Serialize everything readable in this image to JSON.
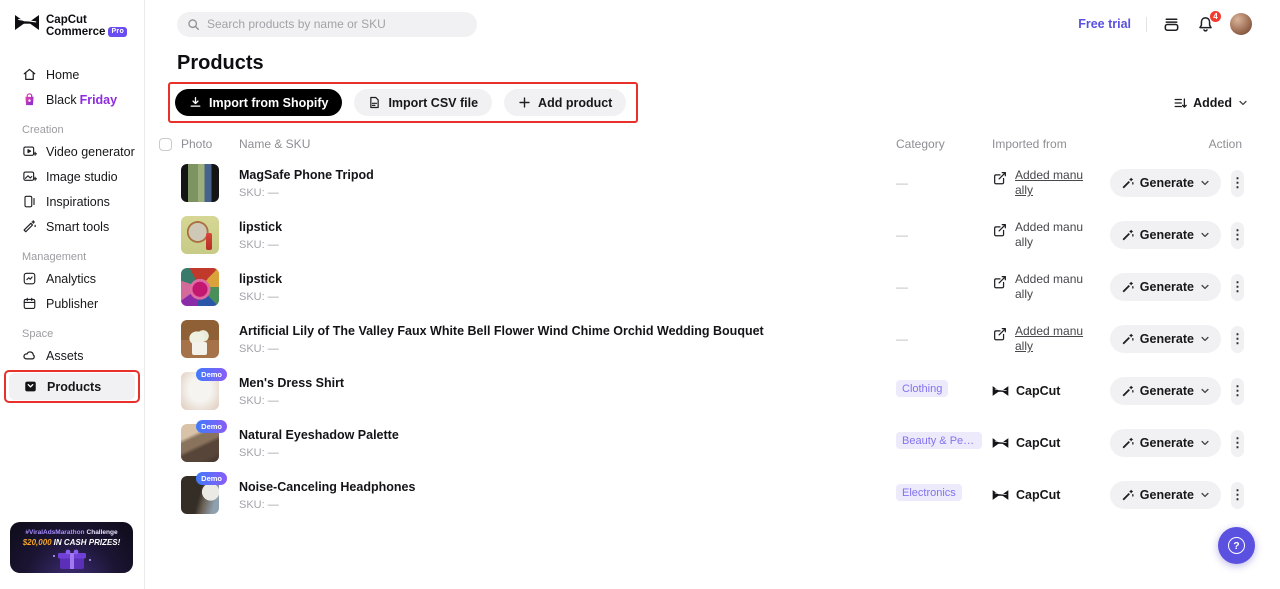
{
  "sidebar": {
    "logo": {
      "line1": "CapCut",
      "line2": "Commerce",
      "badge": "Pro"
    },
    "home": "Home",
    "black_friday": {
      "first": "Black",
      "second": "Friday"
    },
    "sections": [
      {
        "label": "Creation",
        "items": [
          "Video generator",
          "Image studio",
          "Inspirations",
          "Smart tools"
        ]
      },
      {
        "label": "Management",
        "items": [
          "Analytics",
          "Publisher"
        ]
      },
      {
        "label": "Space",
        "items": [
          "Assets",
          "Products"
        ]
      }
    ],
    "banner": {
      "line1_highlight": "#ViralAdsMarathon",
      "line1_rest": "Challenge",
      "line2_amount": "$20,000",
      "line2_rest": "IN CASH PRIZES!"
    }
  },
  "topbar": {
    "search_placeholder": "Search products by name or SKU",
    "free_trial": "Free trial",
    "notification_count": "4"
  },
  "page": {
    "title": "Products"
  },
  "toolbar": {
    "import_shopify": "Import from Shopify",
    "import_csv": "Import CSV file",
    "add_product": "Add product",
    "sort_label": "Added"
  },
  "table": {
    "headers": {
      "photo": "Photo",
      "name_sku": "Name & SKU",
      "category": "Category",
      "imported_from": "Imported from",
      "action": "Action"
    },
    "sku_prefix": "SKU:",
    "category_empty": "—",
    "demo_badge": "Demo",
    "generate_label": "Generate",
    "imported_manual_label": "Added manually",
    "imported_capcut_label": "CapCut",
    "rows": [
      {
        "name": "MagSafe Phone Tripod",
        "sku": "—",
        "category": null,
        "imported": "manual",
        "manual_underline": true,
        "demo": false,
        "photo": "tripod"
      },
      {
        "name": "lipstick",
        "sku": "—",
        "category": null,
        "imported": "manual",
        "manual_underline": false,
        "demo": false,
        "photo": "lipstick-mirror"
      },
      {
        "name": "lipstick",
        "sku": "—",
        "category": null,
        "imported": "manual",
        "manual_underline": false,
        "demo": false,
        "photo": "lipstick-ring"
      },
      {
        "name": "Artificial Lily of The Valley Faux White Bell Flower Wind Chime Orchid Wedding Bouquet",
        "sku": "—",
        "category": null,
        "imported": "manual",
        "manual_underline": true,
        "demo": false,
        "photo": "lily"
      },
      {
        "name": "Men's Dress Shirt",
        "sku": "—",
        "category": "Clothing",
        "imported": "capcut",
        "manual_underline": false,
        "demo": true,
        "photo": "shirt"
      },
      {
        "name": "Natural Eyeshadow Palette",
        "sku": "—",
        "category": "Beauty & Pers...",
        "imported": "capcut",
        "manual_underline": false,
        "demo": true,
        "photo": "palette"
      },
      {
        "name": "Noise-Canceling Headphones",
        "sku": "—",
        "category": "Electronics",
        "imported": "capcut",
        "manual_underline": false,
        "demo": true,
        "photo": "headphones"
      }
    ]
  },
  "icons": {
    "kebab": "⋮",
    "help": "?"
  },
  "colors": {
    "annotation_red": "#e8312a",
    "accent_purple": "#5b51e0",
    "badge_bg": "#edeafc",
    "badge_text": "#8273ee",
    "notif_red": "#f23a2f"
  }
}
